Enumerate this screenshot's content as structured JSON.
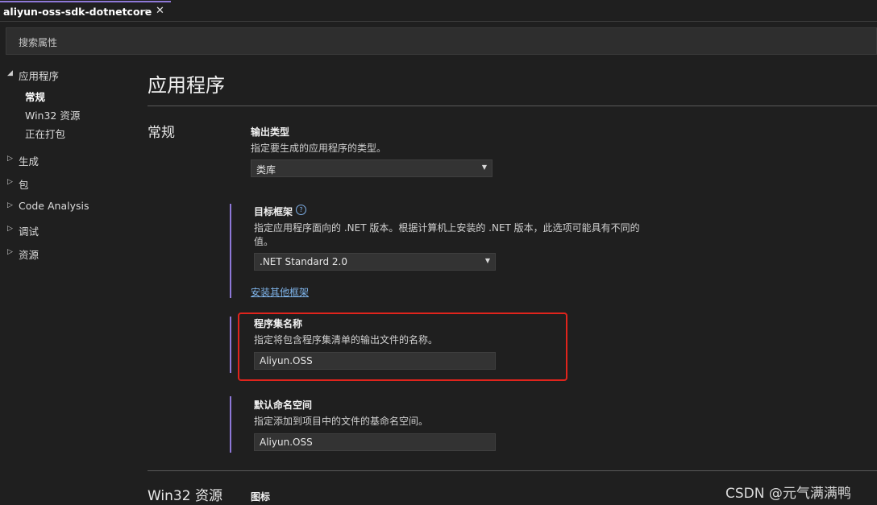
{
  "tab": {
    "title": "aliyun-oss-sdk-dotnetcore",
    "pin_icon": "pin-icon",
    "close_icon": "close-icon"
  },
  "search": {
    "placeholder": "搜索属性"
  },
  "nav": {
    "application": "应用程序",
    "sub_items": [
      "常规",
      "Win32 资源",
      "正在打包"
    ],
    "build": "生成",
    "package": "包",
    "code_analysis": "Code Analysis",
    "debug": "调试",
    "resources": "资源"
  },
  "main": {
    "page_title": "应用程序",
    "section_general": "常规",
    "output_type": {
      "label": "输出类型",
      "desc": "指定要生成的应用程序的类型。",
      "value": "类库"
    },
    "target_framework": {
      "label": "目标框架",
      "desc": "指定应用程序面向的 .NET 版本。根据计算机上安装的 .NET 版本，此选项可能具有不同的值。",
      "value": ".NET Standard 2.0",
      "link": "安装其他框架"
    },
    "assembly_name": {
      "label": "程序集名称",
      "desc": "指定将包含程序集清单的输出文件的名称。",
      "value": "Aliyun.OSS"
    },
    "default_namespace": {
      "label": "默认命名空间",
      "desc": "指定添加到项目中的文件的基命名空间。",
      "value": "Aliyun.OSS"
    },
    "section_win32": "Win32 资源",
    "icon_label": "图标"
  },
  "watermark": "CSDN @元气满满鸭",
  "colors": {
    "accent": "#8e78d8",
    "highlight_box": "#e0241c",
    "link": "#7fb4ea"
  }
}
